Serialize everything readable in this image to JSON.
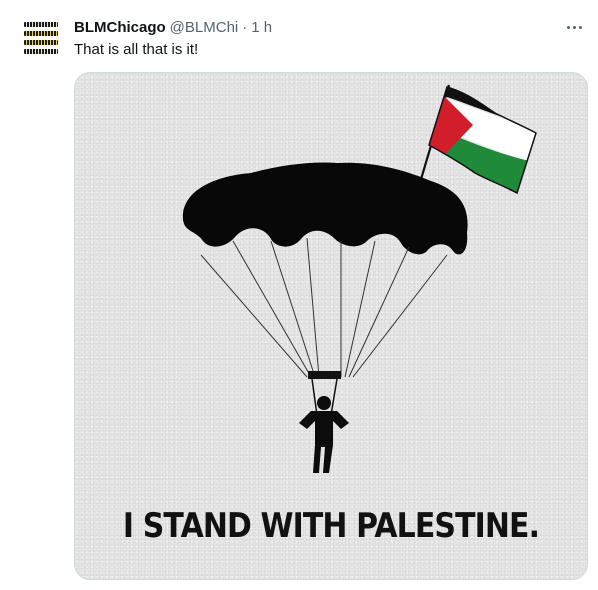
{
  "tweet": {
    "display_name": "BLMChicago",
    "handle": "@BLMChi",
    "separator": "·",
    "time": "1 h",
    "text": "That is all that is it!",
    "avatar_logo_text": "BLACK LIVES MATTER CHICAGO",
    "more_icon": "more-horizontal-icon"
  },
  "media": {
    "caption": "I STAND WITH PALESTINE.",
    "flag_colors": {
      "black": "#111111",
      "white": "#ffffff",
      "green": "#1e8a3a",
      "red": "#d21d2a"
    }
  }
}
